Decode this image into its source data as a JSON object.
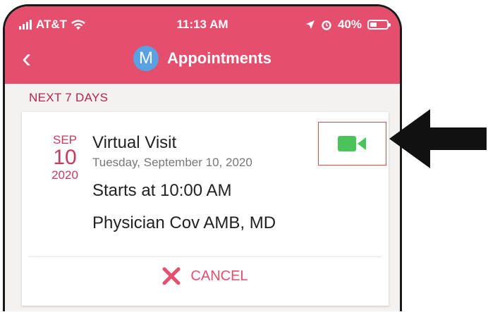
{
  "status": {
    "carrier": "AT&T",
    "time": "11:13 AM",
    "battery": "40%"
  },
  "nav": {
    "avatar_letter": "M",
    "title": "Appointments",
    "back_glyph": "‹"
  },
  "section": {
    "label": "NEXT 7 DAYS"
  },
  "appointment": {
    "month": "SEP",
    "day": "10",
    "year": "2020",
    "type": "Virtual Visit",
    "full_date": "Tuesday, September 10, 2020",
    "start": "Starts at 10:00 AM",
    "physician": "Physician Cov AMB, MD",
    "cancel_label": "CANCEL"
  },
  "colors": {
    "header": "#e34f6d",
    "accent": "#c83a5c",
    "video": "#4cc35a",
    "cancel_x": "#e34f6d"
  },
  "icons": [
    "signal-bars-icon",
    "wifi-icon",
    "location-arrow-icon",
    "alarm-icon",
    "battery-icon",
    "back-chevron-icon",
    "video-camera-icon",
    "close-x-icon",
    "pointer-arrow-icon"
  ]
}
